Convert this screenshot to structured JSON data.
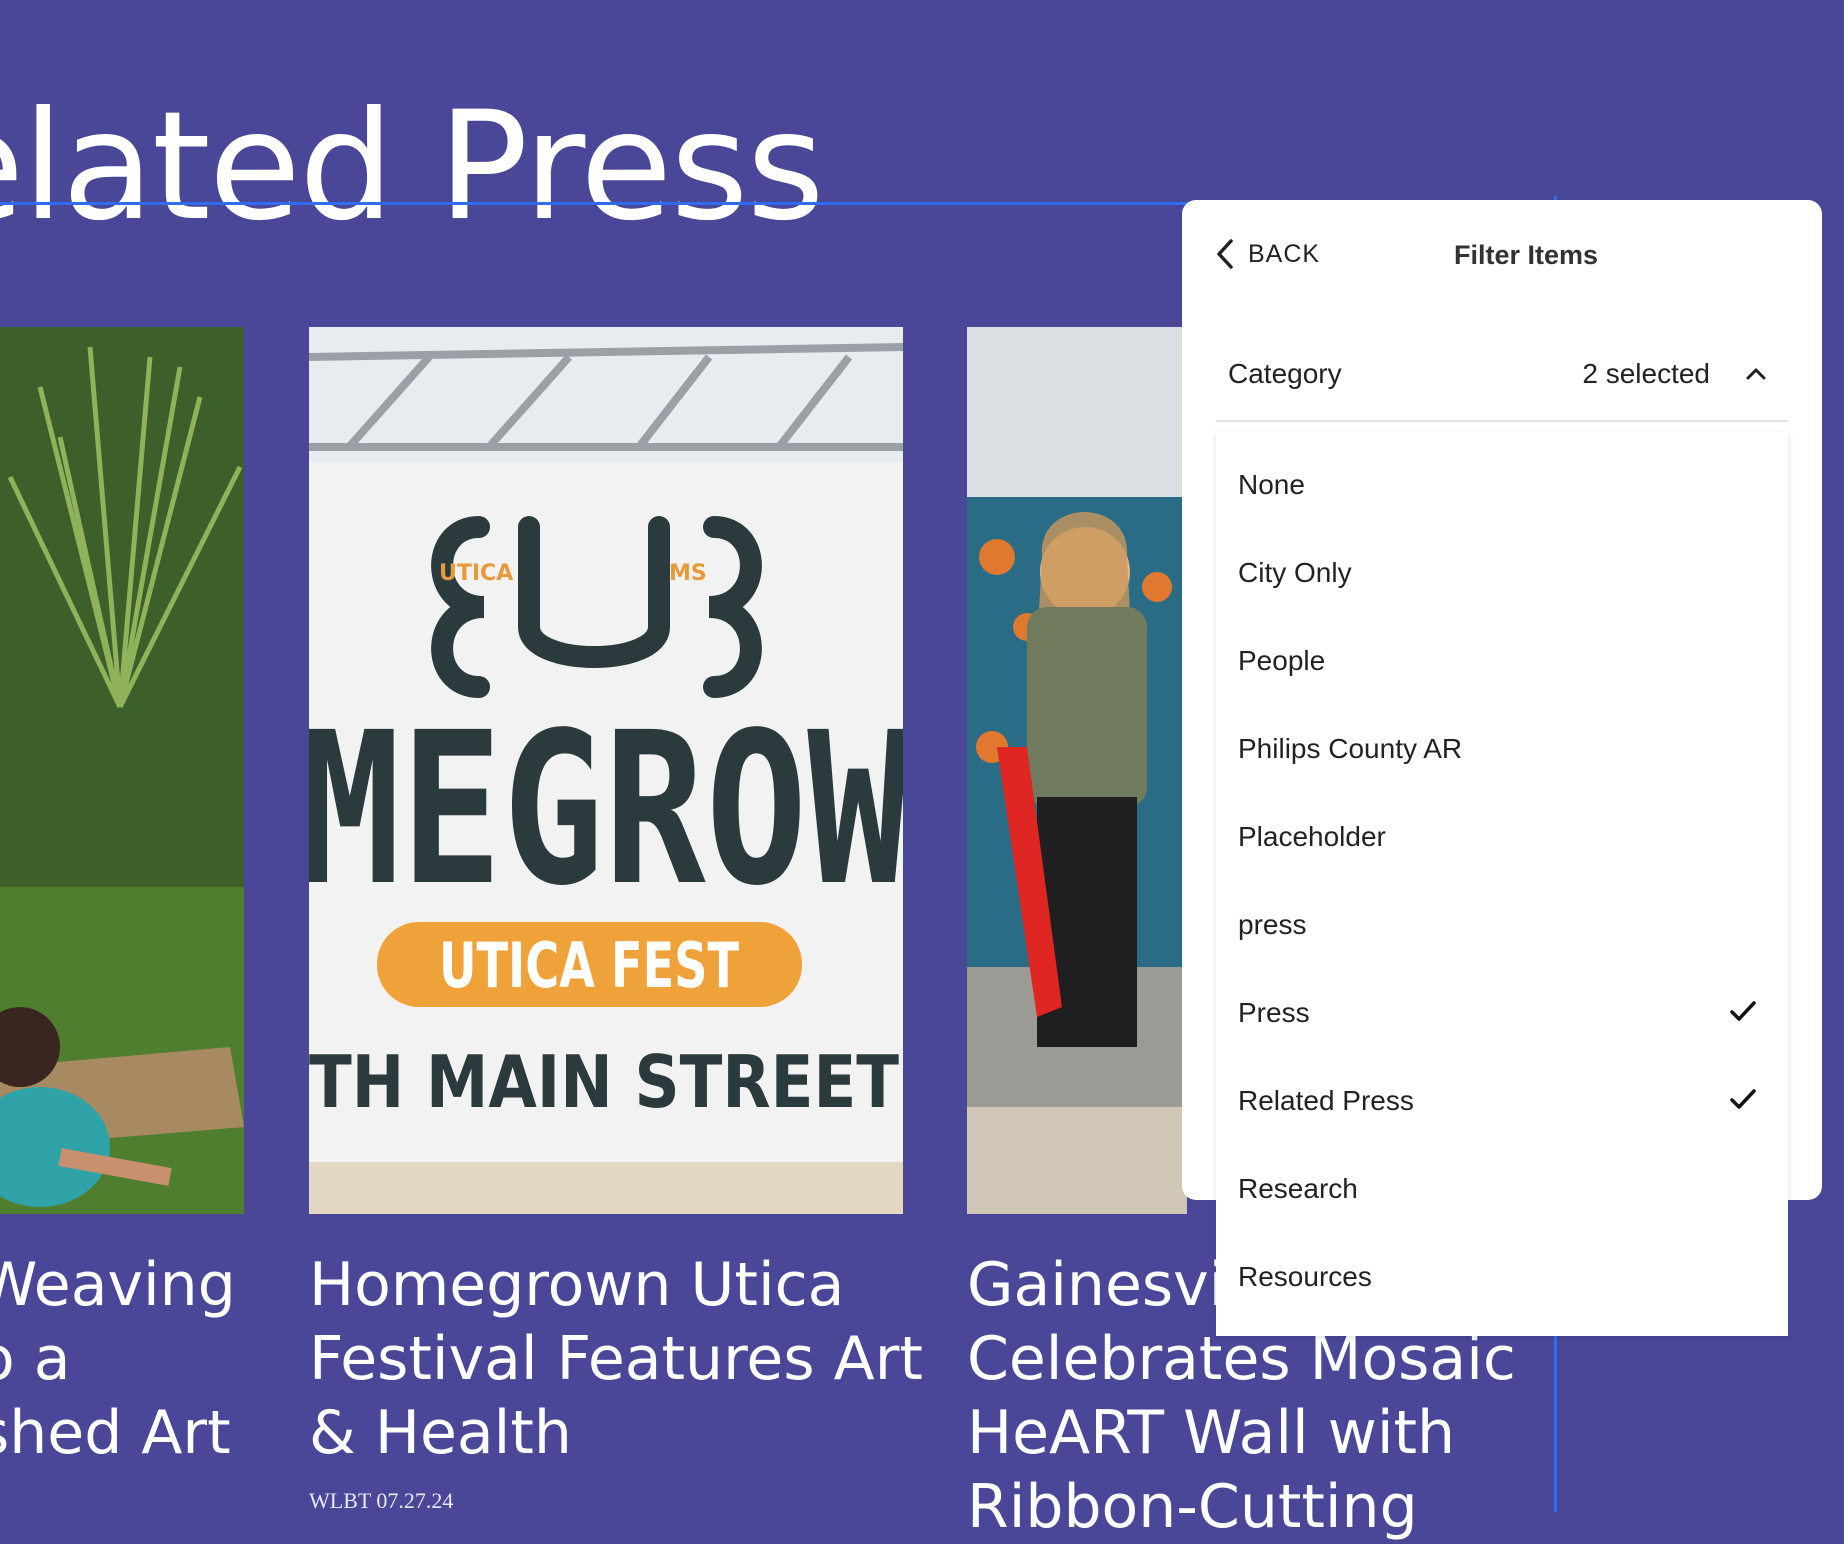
{
  "page": {
    "heading": "elated Press"
  },
  "cards": [
    {
      "title_lines": [
        "Weaving",
        "o a",
        "shed Art"
      ]
    },
    {
      "title_lines": [
        "Homegrown Utica",
        "Festival Features Art",
        "& Health"
      ],
      "meta": "WLBT 07.27.24"
    },
    {
      "title_lines": [
        "Gainesvi",
        "Celebrates Mosaic",
        "HeART Wall with",
        "Ribbon-Cutting"
      ]
    }
  ],
  "banner": {
    "logo_left": "UTICA",
    "logo_right": "MS",
    "big_text": "MEGROW",
    "pill_text": "UTICA FEST",
    "bottom_text": "TH   MAIN STREET"
  },
  "filter": {
    "back_label": "BACK",
    "title": "Filter Items",
    "category_label": "Category",
    "category_count": "2 selected",
    "options": [
      {
        "label": "None",
        "checked": false
      },
      {
        "label": "City Only",
        "checked": false
      },
      {
        "label": "People",
        "checked": false
      },
      {
        "label": "Philips County AR",
        "checked": false
      },
      {
        "label": "Placeholder",
        "checked": false
      },
      {
        "label": "press",
        "checked": false
      },
      {
        "label": "Press",
        "checked": true
      },
      {
        "label": "Related Press",
        "checked": true
      },
      {
        "label": "Research",
        "checked": false
      },
      {
        "label": "Resources",
        "checked": false
      }
    ]
  },
  "colors": {
    "background": "#4a4799",
    "guide": "#2f6cf0",
    "pill": "#f0a23a",
    "banner_text": "#2a3a3d"
  }
}
